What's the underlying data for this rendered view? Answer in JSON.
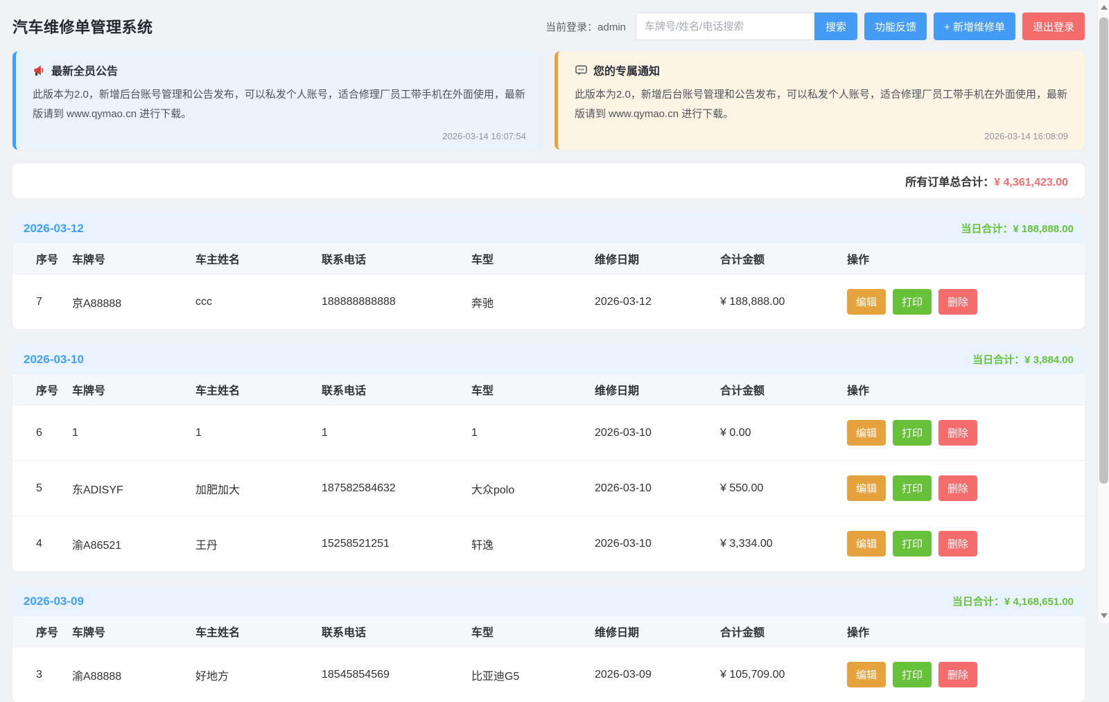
{
  "app": {
    "title": "汽车维修单管理系统"
  },
  "header": {
    "login_label": "当前登录：",
    "login_user": "admin",
    "search_placeholder": "车牌号/姓名/电话搜索",
    "search_button": "搜索",
    "feedback_button": "功能反馈",
    "add_button": "+ 新增维修单",
    "logout_button": "退出登录"
  },
  "notices": [
    {
      "icon": "megaphone-icon",
      "title": "最新全员公告",
      "body": "此版本为2.0，新增后台账号管理和公告发布，可以私发个人账号，适合修理厂员工带手机在外面使用，最新版请到 www.qymao.cn 进行下载。",
      "time": "2026-03-14 16:07:54"
    },
    {
      "icon": "speech-bubble-icon",
      "title": "您的专属通知",
      "body": "此版本为2.0，新增后台账号管理和公告发布，可以私发个人账号，适合修理厂员工带手机在外面使用，最新版请到 www.qymao.cn 进行下载。",
      "time": "2026-03-14 16:08:09"
    }
  ],
  "summary": {
    "label": "所有订单总合计：",
    "amount": "¥ 4,361,423.00"
  },
  "labels": {
    "day_total_label": "当日合计："
  },
  "table": {
    "headers": [
      "序号",
      "车牌号",
      "车主姓名",
      "联系电话",
      "车型",
      "维修日期",
      "合计金额",
      "操作"
    ],
    "actions": {
      "edit": "编辑",
      "print": "打印",
      "delete": "删除"
    }
  },
  "day_groups": [
    {
      "date": "2026-03-12",
      "day_total": "¥ 188,888.00",
      "rows": [
        {
          "seq": "7",
          "plate": "京A88888",
          "owner": "ccc",
          "phone": "188888888888",
          "model": "奔驰",
          "date": "2026-03-12",
          "amount": "¥ 188,888.00"
        }
      ]
    },
    {
      "date": "2026-03-10",
      "day_total": "¥ 3,884.00",
      "rows": [
        {
          "seq": "6",
          "plate": "1",
          "owner": "1",
          "phone": "1",
          "model": "1",
          "date": "2026-03-10",
          "amount": "¥ 0.00"
        },
        {
          "seq": "5",
          "plate": "东ADISYF",
          "owner": "加肥加大",
          "phone": "187582584632",
          "model": "大众polo",
          "date": "2026-03-10",
          "amount": "¥ 550.00"
        },
        {
          "seq": "4",
          "plate": "渝A86521",
          "owner": "王丹",
          "phone": "15258521251",
          "model": "轩逸",
          "date": "2026-03-10",
          "amount": "¥ 3,334.00"
        }
      ]
    },
    {
      "date": "2026-03-09",
      "day_total": "¥ 4,168,651.00",
      "rows": [
        {
          "seq": "3",
          "plate": "渝A88888",
          "owner": "好地方",
          "phone": "18545854569",
          "model": "比亚迪G5",
          "date": "2026-03-09",
          "amount": "¥ 105,709.00"
        }
      ]
    }
  ],
  "colors": {
    "primary": "#409eff",
    "success": "#67c23a",
    "warning": "#e6a23c",
    "danger": "#f56c6c"
  }
}
